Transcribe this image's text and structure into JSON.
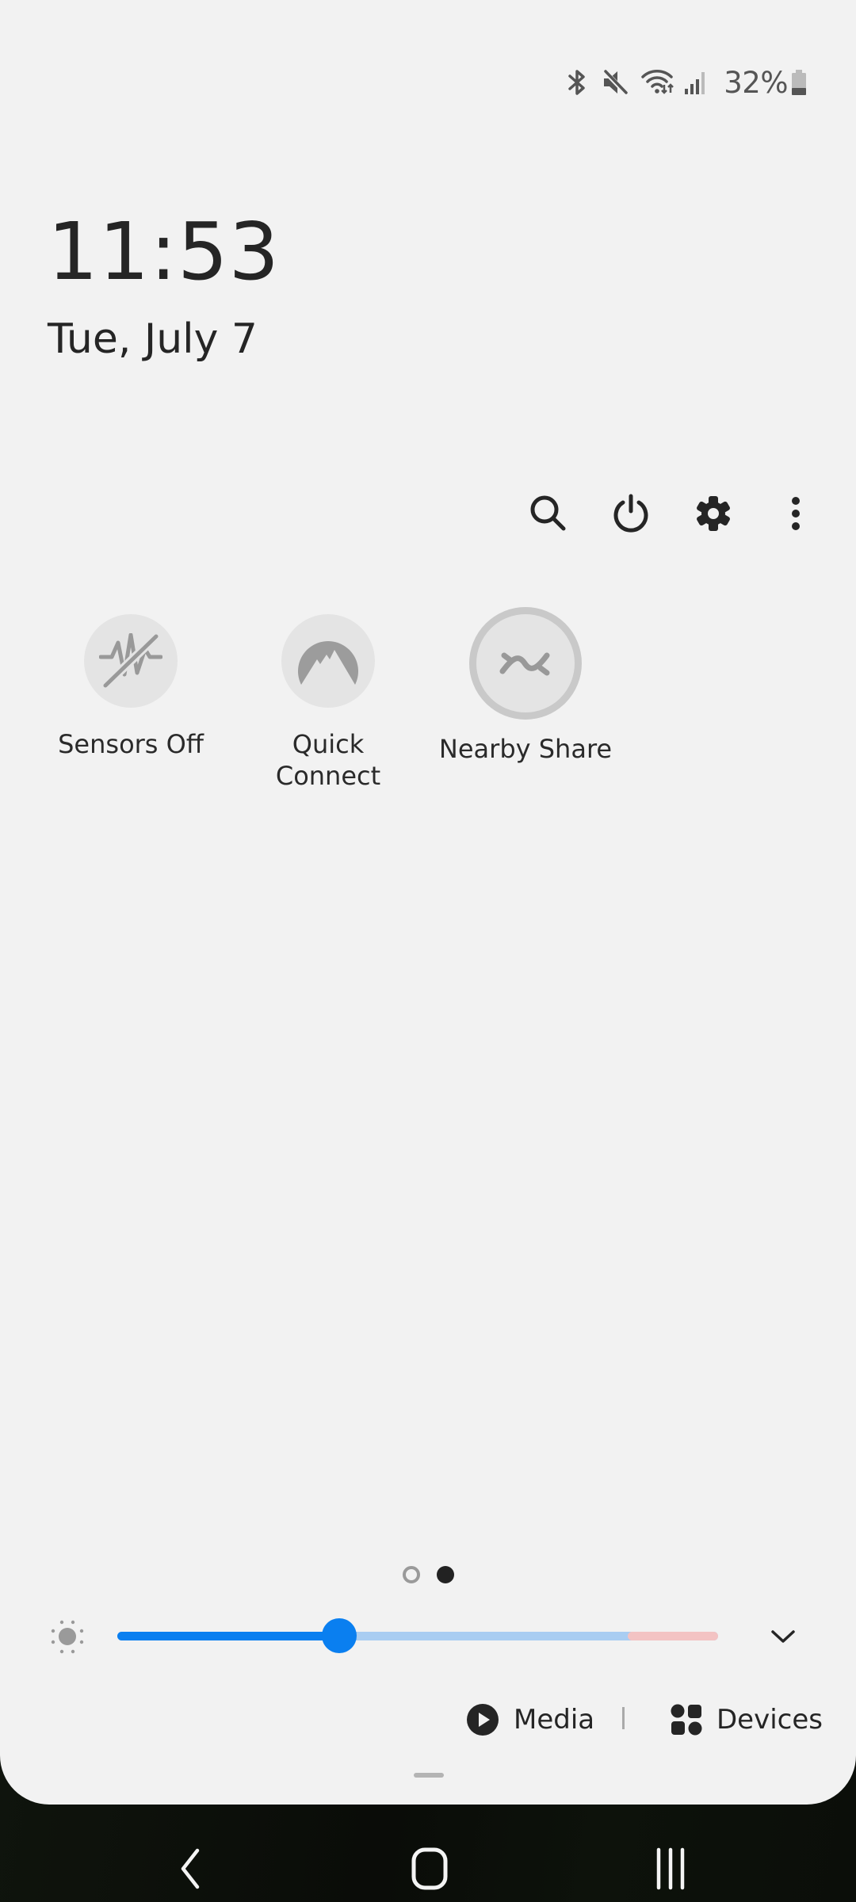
{
  "status_bar": {
    "icons": [
      "bluetooth-icon",
      "mute-icon",
      "wifi-icon",
      "signal-icon",
      "battery-icon"
    ],
    "battery_percent": "32%",
    "battery_level": 0.32
  },
  "clock": {
    "time": "11:53",
    "date": "Tue, July 7"
  },
  "toolbar": {
    "buttons": [
      {
        "icon": "search-icon",
        "label": "Search"
      },
      {
        "icon": "power-icon",
        "label": "Power"
      },
      {
        "icon": "gear-icon",
        "label": "Settings"
      },
      {
        "icon": "more-vert-icon",
        "label": "More options"
      }
    ]
  },
  "quick_tiles": [
    {
      "label": "Sensors Off",
      "icon": "sensors-off-icon",
      "active": false
    },
    {
      "label": "Quick\nConnect",
      "icon": "quick-connect-icon",
      "active": false
    },
    {
      "label": "Nearby Share",
      "icon": "nearby-share-icon",
      "active": false
    }
  ],
  "pager": {
    "pages": 2,
    "current": 2
  },
  "brightness": {
    "icon": "brightness-icon",
    "value": 0.37,
    "extra_brightness_start": 0.85,
    "colors": {
      "fill": "#0a7ff0",
      "track": "#a9cdf2",
      "extra": "#f3c3c3"
    },
    "expand_icon": "chevron-down-icon"
  },
  "bottom_actions": {
    "media_label": "Media",
    "devices_label": "Devices"
  },
  "nav_bar": {
    "back": "back-icon",
    "home": "home-icon",
    "recents": "recents-icon"
  }
}
